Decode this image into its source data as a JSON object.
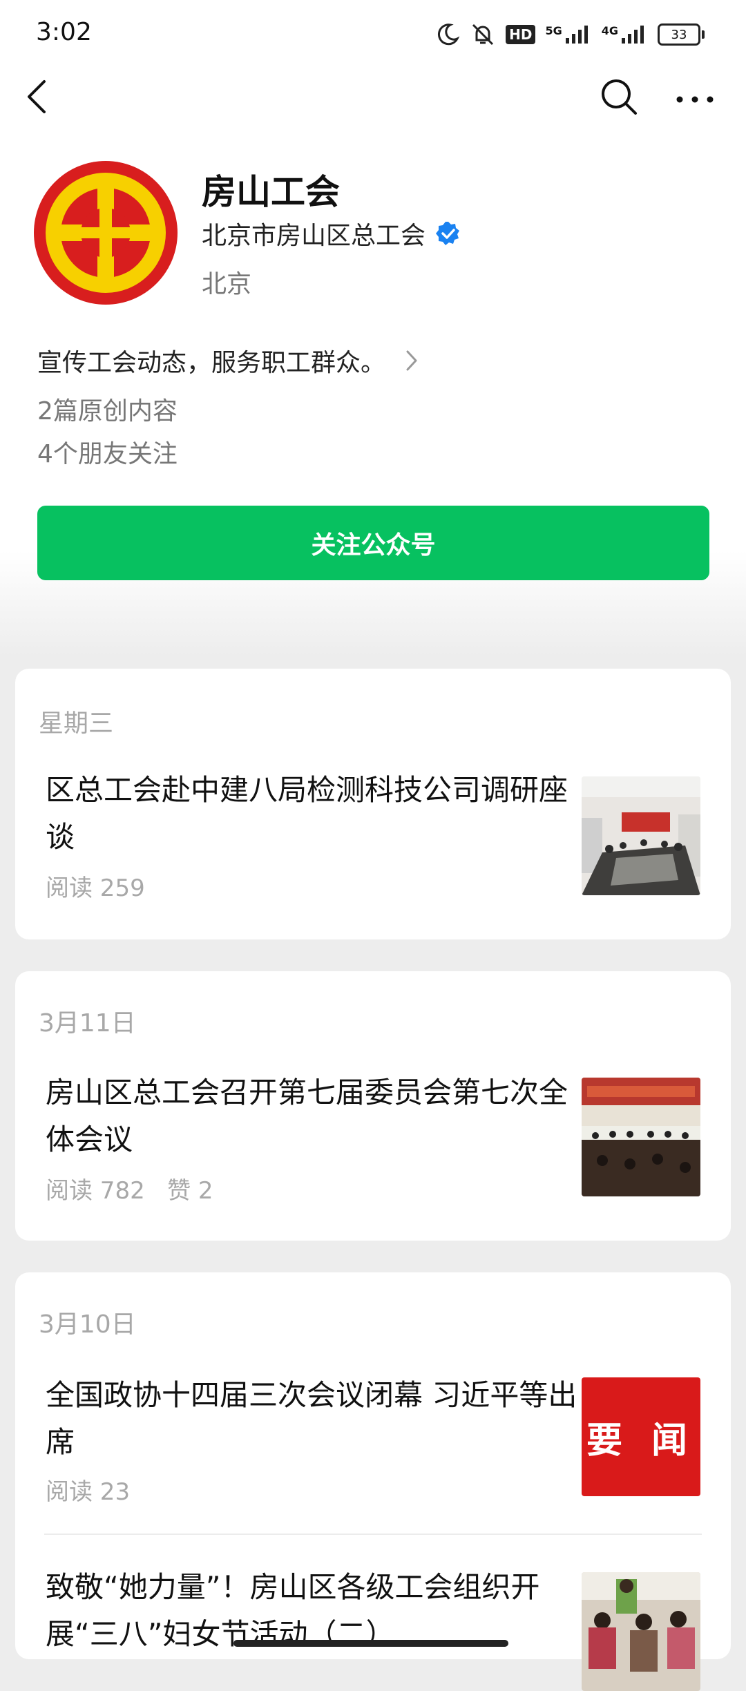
{
  "status": {
    "time": "3:02",
    "network_1": "5G",
    "network_2": "4G",
    "hd": "HD",
    "battery": "33"
  },
  "nav": {
    "back_icon": "chevron-left-icon",
    "search_icon": "search-icon",
    "more_icon": "more-horizontal-icon"
  },
  "account": {
    "name": "房山工会",
    "org": "北京市房山区总工会",
    "location": "北京",
    "description": "宣传工会动态，服务职工群众。",
    "stat_original": "2篇原创内容",
    "stat_friends": "4个朋友关注",
    "follow_label": "关注公众号",
    "verified_color": "#1a82f1",
    "accent": "#07c160"
  },
  "feed": [
    {
      "date": "星期三",
      "articles": [
        {
          "title": "区总工会赴中建八局检测科技公司调研座谈",
          "meta": "阅读 259"
        }
      ]
    },
    {
      "date": "3月11日",
      "articles": [
        {
          "title": "房山区总工会召开第七届委员会第七次全体会议",
          "meta": "阅读 782   赞 2"
        }
      ]
    },
    {
      "date": "3月10日",
      "articles": [
        {
          "title": "全国政协十四届三次会议闭幕 习近平等出席",
          "meta": "阅读 23",
          "thumb_text": "要 闻"
        },
        {
          "title": "致敬“她力量”！房山区各级工会组织开展“三八”妇女节活动（二）",
          "meta": ""
        }
      ]
    }
  ]
}
